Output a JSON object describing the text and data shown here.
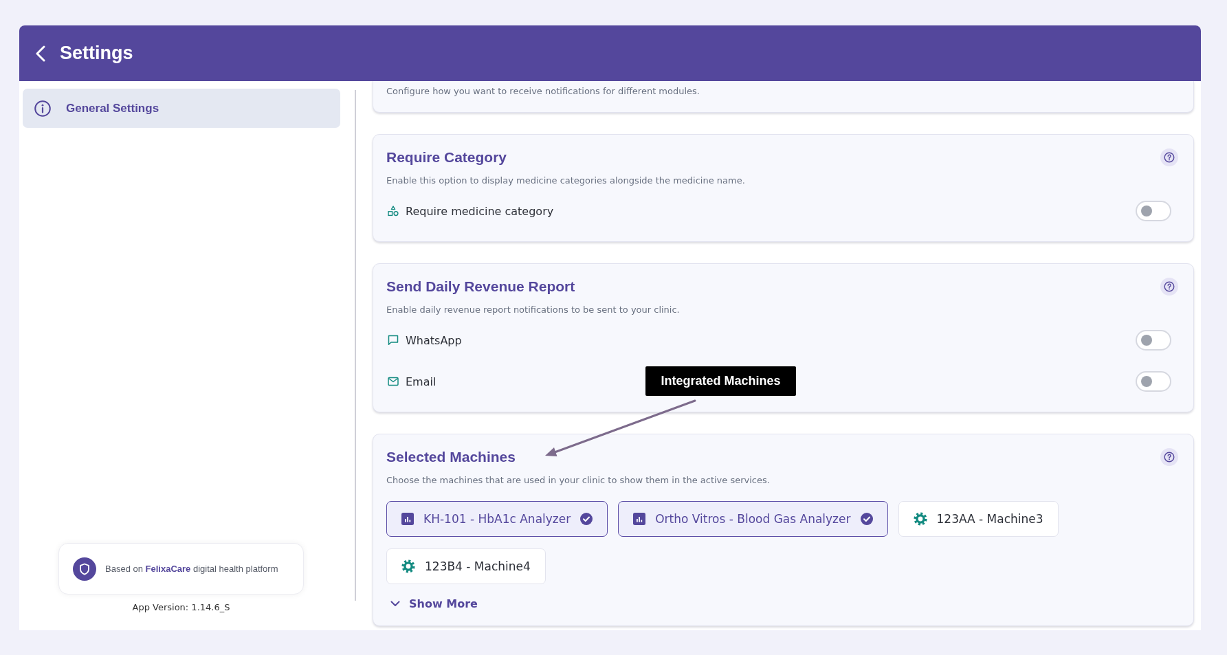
{
  "header": {
    "title": "Settings"
  },
  "sidebar": {
    "items": [
      {
        "label": "General Settings",
        "selected": true
      }
    ],
    "platform_badge": {
      "text": "Based on **FelixaCare** digital health platform"
    },
    "app_version": "App Version: 1.14.6_S"
  },
  "sections": [
    {
      "kind": "partial",
      "description": "Configure how you want to receive notifications for different modules."
    },
    {
      "kind": "toggles",
      "title": "Require Category",
      "description": "Enable this option to display medicine categories alongside the medicine name.",
      "options": [
        {
          "kind": "category",
          "label": "Require medicine category",
          "on": false
        }
      ]
    },
    {
      "kind": "toggles",
      "title": "Send Daily Revenue Report",
      "description": "Enable daily revenue report notifications to be sent to your clinic.",
      "options": [
        {
          "kind": "whatsapp",
          "label": "WhatsApp",
          "on": false
        },
        {
          "kind": "email",
          "label": "Email",
          "on": false
        }
      ]
    },
    {
      "kind": "machines",
      "title": "Selected Machines",
      "description": "Choose the machines that are used in your clinic to show them in the active services.",
      "machines": [
        {
          "label": "KH-101 - HbA1c Analyzer",
          "selected": true
        },
        {
          "label": "Ortho Vitros - Blood Gas Analyzer",
          "selected": true
        },
        {
          "label": "123AA - Machine3",
          "selected": false
        },
        {
          "label": "123B4 - Machine4",
          "selected": false
        }
      ],
      "show_more": "Show More"
    }
  ],
  "annotation": {
    "label": "Integrated Machines"
  }
}
